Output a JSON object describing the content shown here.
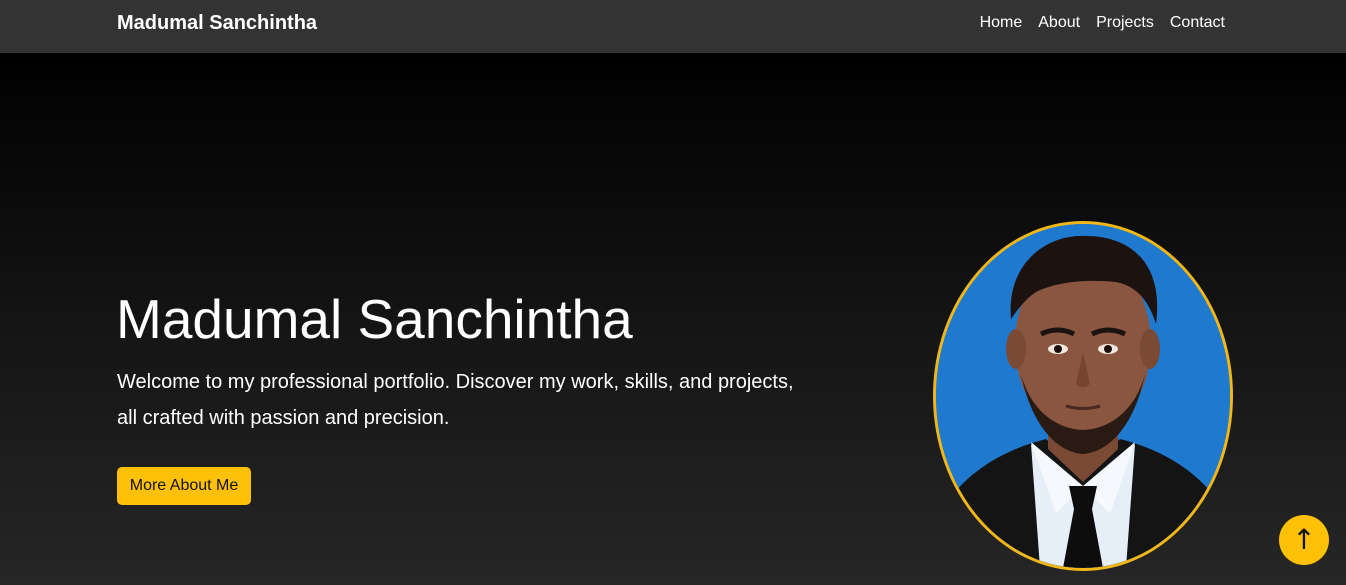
{
  "navbar": {
    "brand": "Madumal Sanchintha",
    "links": [
      "Home",
      "About",
      "Projects",
      "Contact"
    ]
  },
  "hero": {
    "title": "Madumal Sanchintha",
    "subtitle": "Welcome to my professional portfolio. Discover my work, skills, and projects, all crafted with passion and precision.",
    "cta_label": "More About Me"
  },
  "profile": {
    "icon": "profile-photo"
  },
  "scroll_top": {
    "symbol": "↑",
    "icon": "arrow-up-icon"
  },
  "colors": {
    "accent": "#ffc107",
    "navbar_bg": "#333333",
    "hero_bg_top": "#000000",
    "hero_bg_bottom": "#262626"
  }
}
